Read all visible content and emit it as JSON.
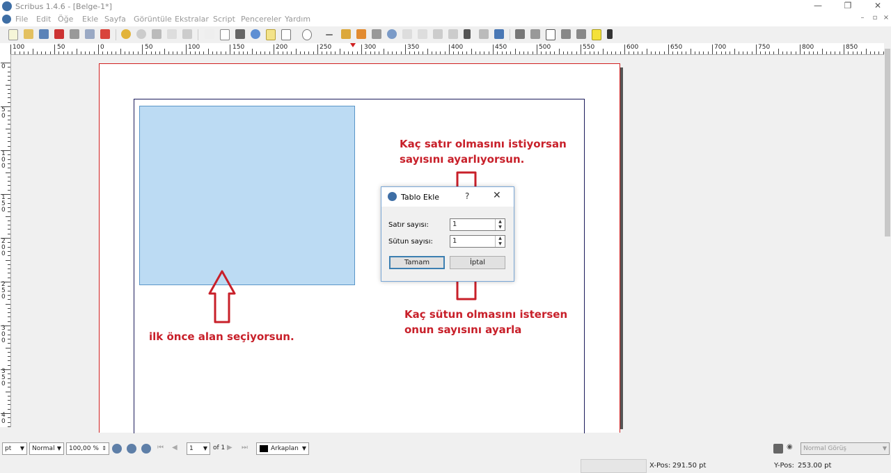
{
  "window": {
    "title": "Scribus 1.4.6 - [Belge-1*]",
    "minimize": "—",
    "restore": "❐",
    "close": "✕"
  },
  "menu": [
    "File",
    "Edit",
    "Öğe",
    "Ekle",
    "Sayfa",
    "Görüntüle",
    "Ekstralar",
    "Script",
    "Pencereler",
    "Yardım"
  ],
  "mdi_controls": [
    "–",
    "▫",
    "×"
  ],
  "ruler_h": [
    "100",
    "50",
    "0",
    "50",
    "100",
    "150",
    "200",
    "250",
    "300",
    "350",
    "400",
    "450",
    "500",
    "550",
    "600",
    "650",
    "700",
    "750",
    "800",
    "850"
  ],
  "ruler_v": [
    "0",
    "5\n0",
    "1\n0\n0",
    "1\n5\n0",
    "2\n0\n0",
    "2\n5\n0",
    "3\n0\n0",
    "3\n5\n0",
    "4\n0"
  ],
  "annotations": {
    "rows_note": "Kaç satır olmasını istiyorsan\nsayısını ayarlıyorsun.",
    "cols_note": "Kaç sütun olmasını istersen\nonun sayısını ayarla",
    "area_note": "ilk önce alan seçiyorsun."
  },
  "dialog": {
    "title": "Tablo Ekle",
    "help": "?",
    "close": "✕",
    "rows_label": "Satır sayısı:",
    "rows_value": "1",
    "cols_label": "Sütun sayısı:",
    "cols_value": "1",
    "ok_label": "Tamam",
    "cancel_label": "İptal"
  },
  "status": {
    "unit": "pt",
    "mode": "Normal",
    "zoom": "100,00 %",
    "page_number": "1",
    "page_of": "of 1",
    "layer": "Arkaplan",
    "view_mode": "Normal Görüş",
    "xpos_label": "X-Pos:",
    "xpos_value": "291.50 pt",
    "ypos_label": "Y-Pos:",
    "ypos_value": "253.00 pt"
  },
  "colors": {
    "accent": "#3e6ea5",
    "annotation": "#c8202a",
    "frame_fill": "#bcdbf3",
    "page_border": "#d02020"
  }
}
